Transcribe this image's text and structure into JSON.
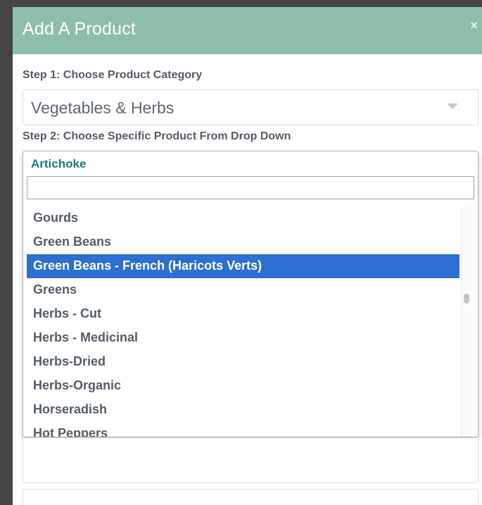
{
  "modal": {
    "title": "Add A Product",
    "close_icon": "close-icon"
  },
  "step1": {
    "label": "Step 1: Choose Product Category",
    "selected": "Vegetables & Herbs"
  },
  "step2": {
    "label": "Step 2: Choose Specific Product From Drop Down",
    "selected": "Artichoke",
    "search_value": "",
    "options": [
      "Gourds",
      "Green Beans",
      "Green Beans - French (Haricots Verts)",
      "Greens",
      "Herbs - Cut",
      "Herbs - Medicinal",
      "Herbs-Dried",
      "Herbs-Organic",
      "Horseradish",
      "Hot Peppers"
    ],
    "highlighted_index": 2
  },
  "colors": {
    "header": "#8fbfaa",
    "highlight": "#2d6fd2",
    "selected_text": "#1b7a7a"
  }
}
